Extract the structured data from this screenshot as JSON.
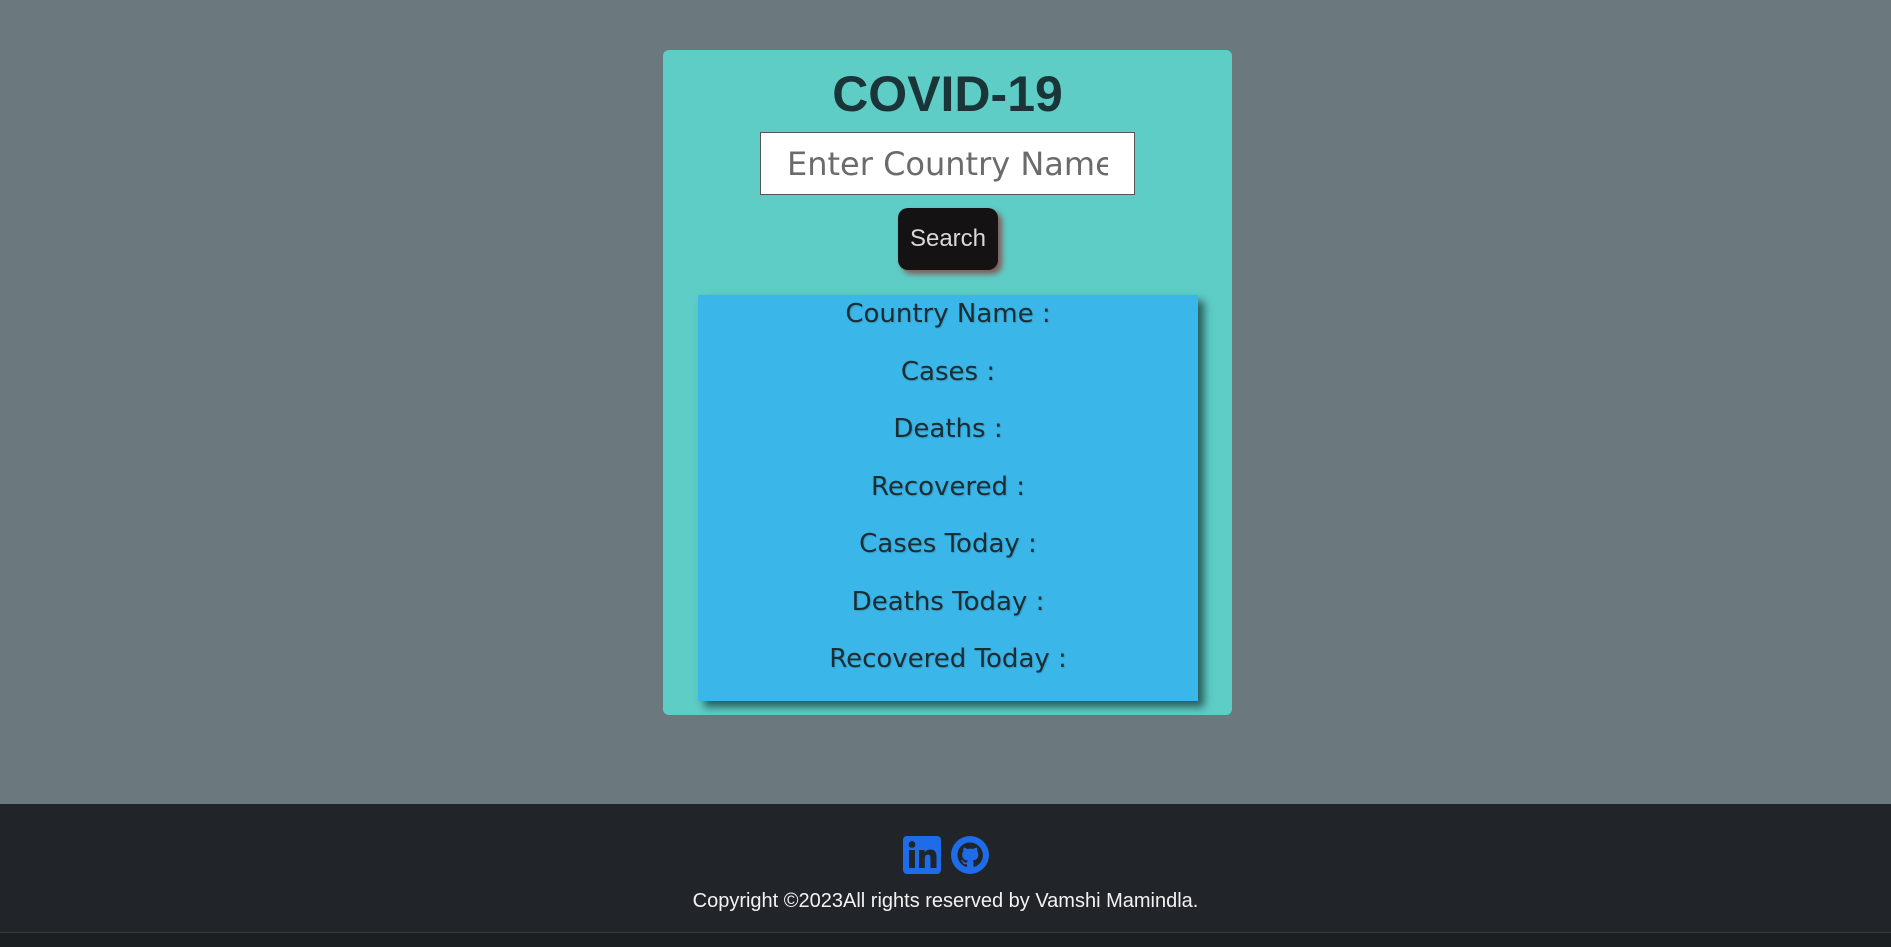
{
  "app": {
    "title": "COVID-19"
  },
  "search": {
    "placeholder": "Enter Country Name",
    "value": "",
    "button_label": "Search"
  },
  "stats": [
    {
      "label": "Country Name :",
      "value": ""
    },
    {
      "label": "Cases :",
      "value": ""
    },
    {
      "label": "Deaths :",
      "value": ""
    },
    {
      "label": "Recovered :",
      "value": ""
    },
    {
      "label": "Cases Today :",
      "value": ""
    },
    {
      "label": "Deaths Today :",
      "value": ""
    },
    {
      "label": "Recovered Today :",
      "value": ""
    }
  ],
  "footer": {
    "links": [
      {
        "icon": "linkedin-icon"
      },
      {
        "icon": "github-icon"
      }
    ],
    "copyright": "Copyright ©2023All rights reserved by Vamshi Mamindla."
  },
  "colors": {
    "page_background": "#6b787e",
    "card_background": "#5ecdc6",
    "info_background": "#3bb6e8",
    "button_background": "#141212",
    "footer_background": "#212428",
    "icon_blue": "#1e6ce8"
  }
}
